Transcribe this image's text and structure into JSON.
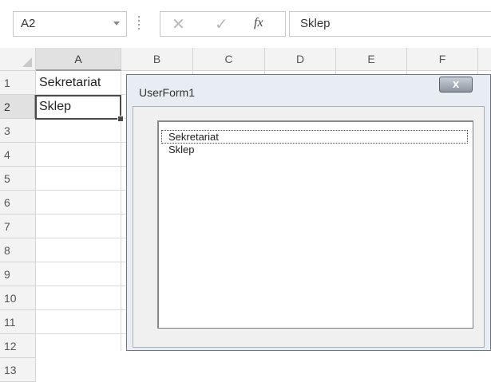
{
  "formula_bar": {
    "name_box": "A2",
    "cancel_icon": "✕",
    "enter_icon": "✓",
    "fx_label": "fx",
    "formula_value": "Sklep"
  },
  "sheet": {
    "columns": [
      "A",
      "B",
      "C",
      "D",
      "E",
      "F"
    ],
    "rows": [
      "1",
      "2",
      "3",
      "4",
      "5",
      "6",
      "7",
      "8",
      "9",
      "10",
      "11",
      "12",
      "13"
    ],
    "cells": {
      "A1": "Sekretariat",
      "A2": "Sklep"
    },
    "active_cell": "A2"
  },
  "userform": {
    "title": "UserForm1",
    "close_label": "x",
    "listbox_items": [
      "Sekretariat",
      "Sklep"
    ]
  }
}
